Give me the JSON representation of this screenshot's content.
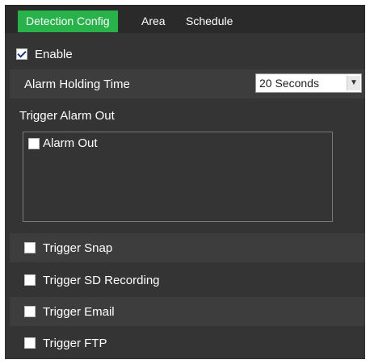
{
  "tabs": [
    {
      "label": "Detection Config",
      "active": true
    },
    {
      "label": "Area",
      "active": false
    },
    {
      "label": "Schedule",
      "active": false
    }
  ],
  "enable": {
    "label": "Enable",
    "checked": true
  },
  "alarm_holding_time": {
    "label": "Alarm Holding Time",
    "value": "20 Seconds"
  },
  "trigger_alarm_out": {
    "label": "Trigger Alarm Out"
  },
  "alarm_out": {
    "label": "Alarm Out",
    "checked": false
  },
  "trigger_snap": {
    "label": "Trigger Snap",
    "checked": false
  },
  "trigger_sd_recording": {
    "label": "Trigger SD Recording",
    "checked": false
  },
  "trigger_email": {
    "label": "Trigger Email",
    "checked": false
  },
  "trigger_ftp": {
    "label": "Trigger FTP",
    "checked": false
  },
  "colors": {
    "accent": "#28b34a",
    "panel": "#343434",
    "row_alt": "#3d3d3d"
  }
}
